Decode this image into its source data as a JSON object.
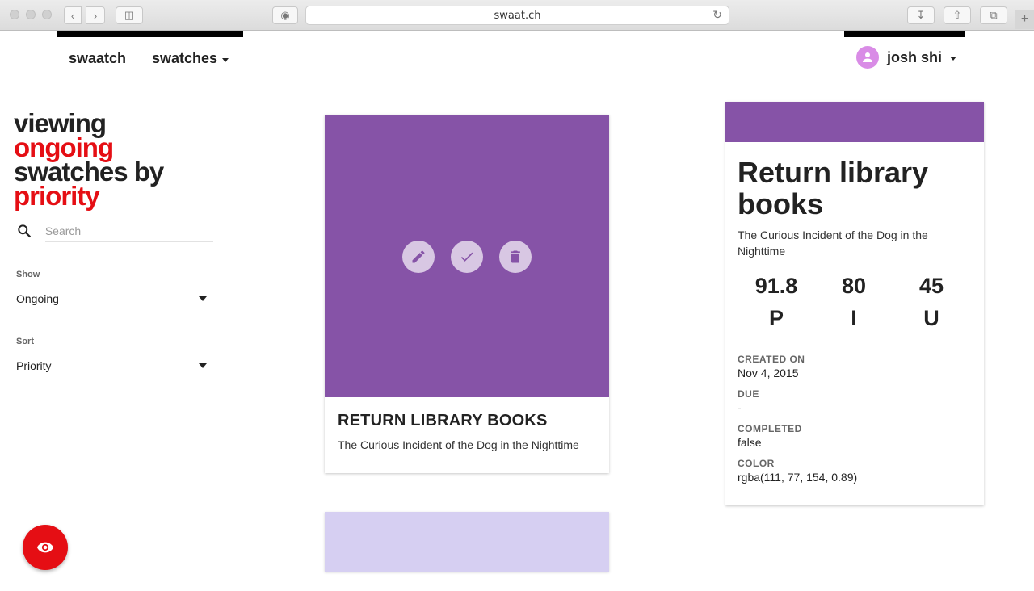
{
  "browser": {
    "url": "swaat.ch"
  },
  "nav": {
    "brand": "swaatch",
    "swatches_menu": "swatches",
    "user_name": "josh shi"
  },
  "sidebar": {
    "heading": {
      "line1": "viewing",
      "filter_word": "ongoing",
      "line3": "swatches by",
      "sort_word": "priority"
    },
    "search": {
      "placeholder": "Search",
      "value": ""
    },
    "show": {
      "label": "Show",
      "value": "Ongoing"
    },
    "sort": {
      "label": "Sort",
      "value": "Priority"
    }
  },
  "cards": [
    {
      "title": "RETURN LIBRARY BOOKS",
      "subtitle": "The Curious Incident of the Dog in the Nighttime",
      "color": "#8653a7"
    },
    {
      "color": "#d6cff2"
    }
  ],
  "detail": {
    "title": "Return library books",
    "description": "The Curious Incident of the Dog in the Nighttime",
    "stats": [
      {
        "value": "91.8",
        "label": "P"
      },
      {
        "value": "80",
        "label": "I"
      },
      {
        "value": "45",
        "label": "U"
      }
    ],
    "created_on_label": "CREATED ON",
    "created_on": "Nov 4, 2015",
    "due_label": "DUE",
    "due": "-",
    "completed_label": "COMPLETED",
    "completed": "false",
    "color_label": "COLOR",
    "color": "rgba(111, 77, 154, 0.89)"
  },
  "colors": {
    "accent_red": "#e50e14",
    "swatch_purple": "#8653a7",
    "avatar": "#d98ce6"
  }
}
